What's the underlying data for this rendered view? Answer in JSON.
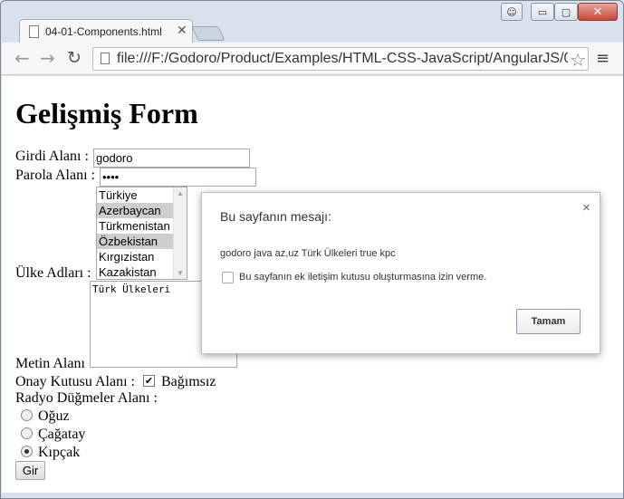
{
  "browser": {
    "tab_title": "04-01-Components.html",
    "url": "file:///F:/Godoro/Product/Examples/HTML-CSS-JavaScript/AngularJS/0",
    "close_glyph": "✕",
    "minimize_glyph": "▭",
    "maximize_glyph": "▢",
    "back_glyph": "←",
    "forward_glyph": "→",
    "reload_glyph": "↻",
    "star_glyph": "☆",
    "menu_glyph": "≡"
  },
  "page": {
    "heading": "Gelişmiş Form",
    "text_field": {
      "label": "Girdi Alanı :",
      "value": "godoro"
    },
    "password_field": {
      "label": "Parola Alanı :",
      "value": "••••"
    },
    "country_list": {
      "label": "Ülke Adları :",
      "options": [
        {
          "label": "Türkiye",
          "selected": false
        },
        {
          "label": "Azerbaycan",
          "selected": true
        },
        {
          "label": "Türkmenistan",
          "selected": false
        },
        {
          "label": "Özbekistan",
          "selected": true
        },
        {
          "label": "Kırgızistan",
          "selected": false
        },
        {
          "label": "Kazakistan",
          "selected": false
        }
      ]
    },
    "textarea": {
      "label": "Metin Alanı",
      "value": "Türk Ülkeleri"
    },
    "checkbox": {
      "label": "Onay Kutusu Alanı :",
      "option_label": "Bağımsız",
      "checked": true,
      "check_glyph": "✔"
    },
    "radio_group": {
      "label": "Radyo Düğmeler Alanı :",
      "options": [
        {
          "label": "Oğuz",
          "checked": false
        },
        {
          "label": "Çağatay",
          "checked": false
        },
        {
          "label": "Kıpçak",
          "checked": true
        }
      ]
    },
    "submit_label": "Gir"
  },
  "dialog": {
    "title": "Bu sayfanın mesajı:",
    "close_glyph": "×",
    "message": "godoro java az,uz Türk Ülkeleri true kpc",
    "suppress_label": "Bu sayfanın ek iletişim kutusu oluşturmasına izin verme.",
    "ok_label": "Tamam"
  }
}
